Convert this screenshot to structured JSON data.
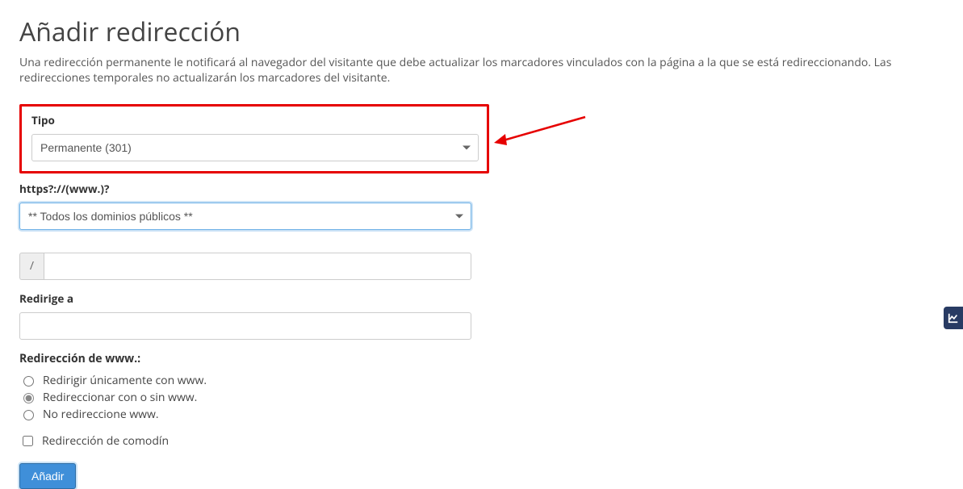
{
  "title": "Añadir redirección",
  "description": "Una redirección permanente le notificará al navegador del visitante que debe actualizar los marcadores vinculados con la página a la que se está redireccionando. Las redirecciones temporales no actualizarán los marcadores del visitante.",
  "tipo": {
    "label": "Tipo",
    "selected": "Permanente (301)"
  },
  "domain": {
    "label": "https?://(www.)?",
    "selected": "** Todos los dominios públicos **"
  },
  "path_prefix": "/",
  "path_value": "",
  "redirect_to": {
    "label": "Redirige a",
    "value": ""
  },
  "www_redirect": {
    "label": "Redirección de www.:",
    "opt1": "Redirigir únicamente con www.",
    "opt2": "Redireccionar con o sin www.",
    "opt3": "No redireccione www."
  },
  "wildcard_label": "Redirección de comodín",
  "submit_label": "Añadir"
}
